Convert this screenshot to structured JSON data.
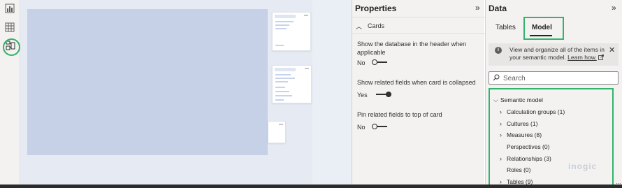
{
  "left_rail": {
    "icons": [
      "report-view-icon",
      "table-view-icon",
      "model-view-icon"
    ]
  },
  "properties": {
    "title": "Properties",
    "section_label": "Cards",
    "settings": [
      {
        "label": "Show the database in the header when applicable",
        "value": "No",
        "state": "off"
      },
      {
        "label": "Show related fields when card is collapsed",
        "value": "Yes",
        "state": "on"
      },
      {
        "label": "Pin related fields to top of card",
        "value": "No",
        "state": "off"
      }
    ]
  },
  "data_pane": {
    "title": "Data",
    "tabs": {
      "tables": "Tables",
      "model": "Model"
    },
    "info": {
      "text": "View and organize all of the items in your semantic model.",
      "link": "Learn how."
    },
    "search": {
      "placeholder": "Search"
    },
    "tree": {
      "root": "Semantic model",
      "items": [
        {
          "label": "Calculation groups (1)",
          "expandable": true
        },
        {
          "label": "Cultures (1)",
          "expandable": true
        },
        {
          "label": "Measures (8)",
          "expandable": true
        },
        {
          "label": "Perspectives (0)",
          "expandable": false
        },
        {
          "label": "Relationships (3)",
          "expandable": true
        },
        {
          "label": "Roles (0)",
          "expandable": false
        },
        {
          "label": "Tables (9)",
          "expandable": true
        }
      ]
    },
    "watermark": "inogic",
    "more_label": "..."
  },
  "colors": {
    "highlight": "#33b36b",
    "canvas_bg": "#e6ebf3",
    "board": "#c6d0e6",
    "pane_bg": "#f3f2f1"
  }
}
